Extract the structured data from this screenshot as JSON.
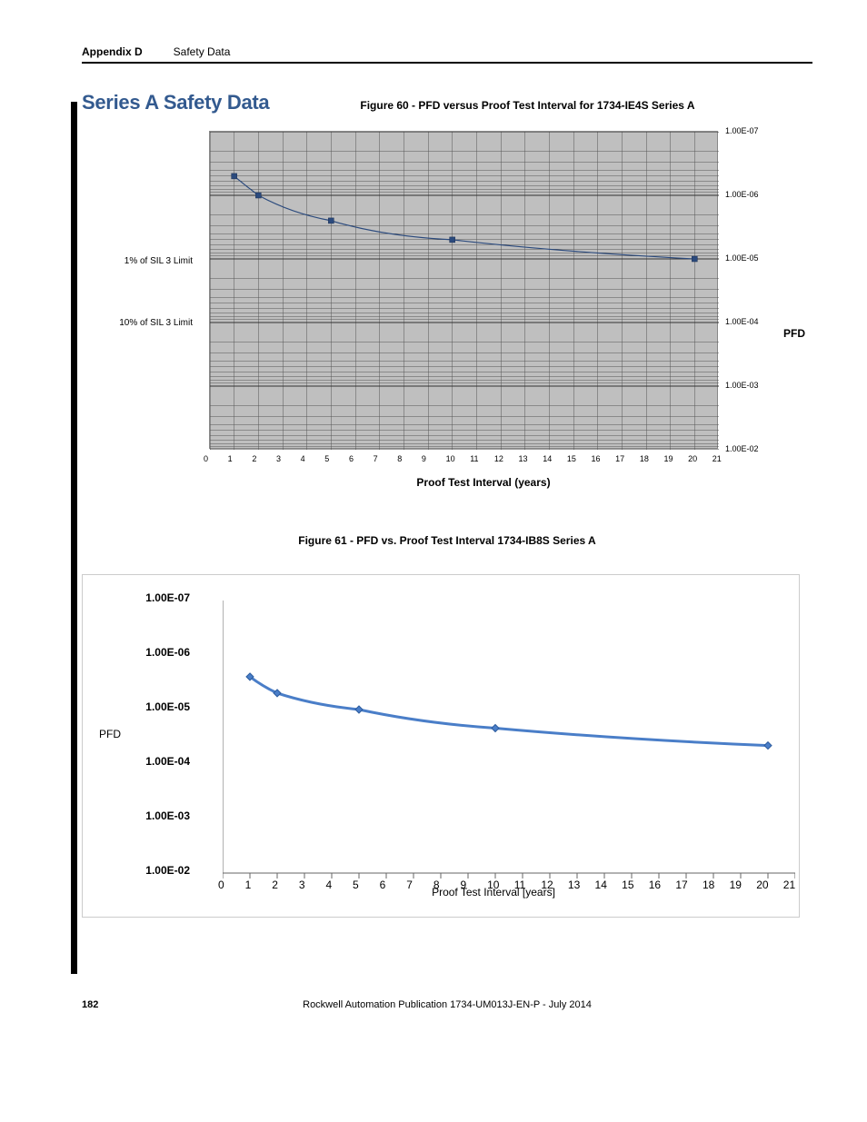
{
  "header": {
    "appendix": "Appendix D",
    "section": "Safety Data"
  },
  "heading": "Series A Safety Data",
  "figure60": {
    "caption": "Figure 60 - PFD versus Proof Test Interval for 1734-IE4S Series A",
    "xlabel": "Proof Test Interval (years)",
    "ylabel_right": "PFD",
    "left_annotations": {
      "one_pct": "1% of SIL 3 Limit",
      "ten_pct": "10% of SIL 3 Limit"
    },
    "x_ticks": [
      "0",
      "1",
      "2",
      "3",
      "4",
      "5",
      "6",
      "7",
      "8",
      "9",
      "10",
      "11",
      "12",
      "13",
      "14",
      "15",
      "16",
      "17",
      "18",
      "19",
      "20",
      "21"
    ],
    "y_ticks": [
      "1.00E-07",
      "1.00E-06",
      "1.00E-05",
      "1.00E-04",
      "1.00E-03",
      "1.00E-02"
    ]
  },
  "figure61": {
    "caption": "Figure 61 - PFD vs. Proof Test Interval 1734-IB8S Series A",
    "xlabel": "Proof Test Interval [years]",
    "ylabel": "PFD",
    "x_ticks": [
      "0",
      "1",
      "2",
      "3",
      "4",
      "5",
      "6",
      "7",
      "8",
      "9",
      "10",
      "11",
      "12",
      "13",
      "14",
      "15",
      "16",
      "17",
      "18",
      "19",
      "20",
      "21"
    ],
    "y_ticks": [
      "1.00E-07",
      "1.00E-06",
      "1.00E-05",
      "1.00E-04",
      "1.00E-03",
      "1.00E-02"
    ]
  },
  "footer": {
    "page": "182",
    "pub": "Rockwell Automation Publication 1734-UM013J-EN-P - July 2014"
  },
  "chart_data": [
    {
      "type": "line",
      "title": "Figure 60 - PFD versus Proof Test Interval for 1734-IE4S Series A",
      "xlabel": "Proof Test Interval (years)",
      "ylabel": "PFD",
      "y_scale": "log_inverted",
      "ylim": [
        1e-07,
        0.01
      ],
      "x": [
        1,
        2,
        5,
        10,
        20
      ],
      "y": [
        5e-07,
        1e-06,
        2.5e-06,
        5e-06,
        1e-05
      ],
      "reference_lines": [
        {
          "label": "1% of SIL 3 Limit",
          "y": 1e-05
        },
        {
          "label": "10% of SIL 3 Limit",
          "y": 0.0001
        }
      ]
    },
    {
      "type": "line",
      "title": "Figure 61 - PFD vs. Proof Test Interval 1734-IB8S Series A",
      "xlabel": "Proof Test Interval [years]",
      "ylabel": "PFD",
      "y_scale": "log_inverted",
      "ylim": [
        1e-07,
        0.01
      ],
      "x": [
        1,
        2,
        5,
        10,
        20
      ],
      "y": [
        2.5e-06,
        5e-06,
        1e-05,
        2.2e-05,
        4.5e-05
      ]
    }
  ]
}
